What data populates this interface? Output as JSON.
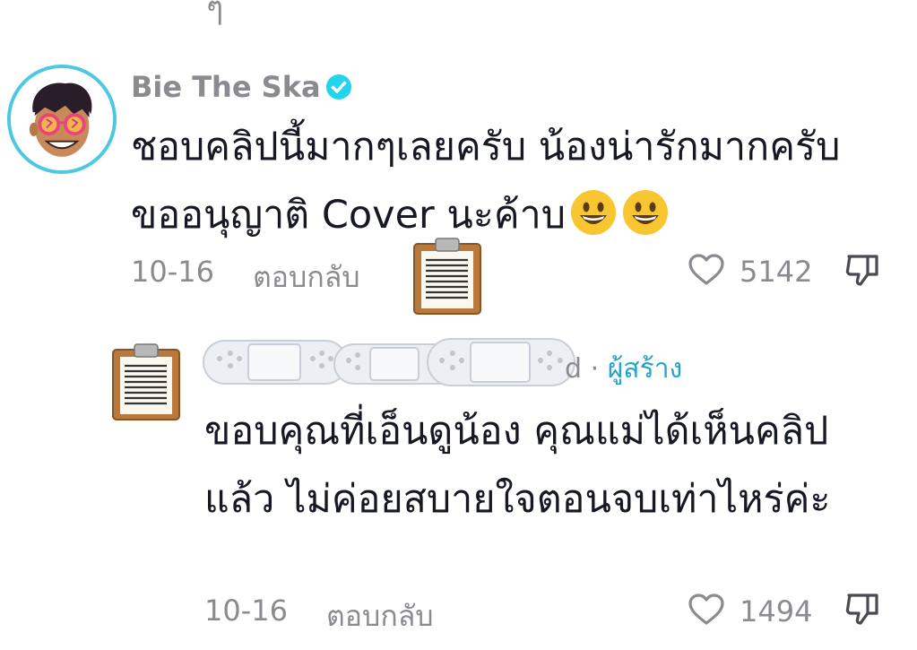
{
  "top_partial": "ๆ",
  "comment": {
    "username": "Bie The Ska",
    "text": "ชอบคลิปนี้มากๆเลยครับ น้องน่ารักมากครับ ขออนุญาติ Cover นะค้าบ",
    "emoji": [
      "grinning-face",
      "grinning-face"
    ],
    "date": "10-16",
    "reply_label": "ตอบกลับ",
    "likes": "5142"
  },
  "reply": {
    "username_visible_suffix": "d",
    "author_badge": "ผู้สร้าง",
    "separator": "·",
    "text": "ขอบคุณที่เอ็นดูน้อง คุณแม่ได้เห็นคลิปแล้ว ไม่ค่อยสบายใจตอนจบเท่าไหร่ค่ะ",
    "date": "10-16",
    "reply_label": "ตอบกลับ",
    "likes": "1494"
  },
  "icons": {
    "heart": "heart-outline-icon",
    "dislike": "thumbs-down-icon",
    "verified": "verified-badge-icon",
    "clipboard": "clipboard-emoji",
    "bandage": "bandage-emoji"
  },
  "colors": {
    "verified": "#20d5ec",
    "creator_tag": "#25a4c8",
    "meta_gray": "#8a8b91",
    "avatar_ring": "#4cc9e0"
  }
}
